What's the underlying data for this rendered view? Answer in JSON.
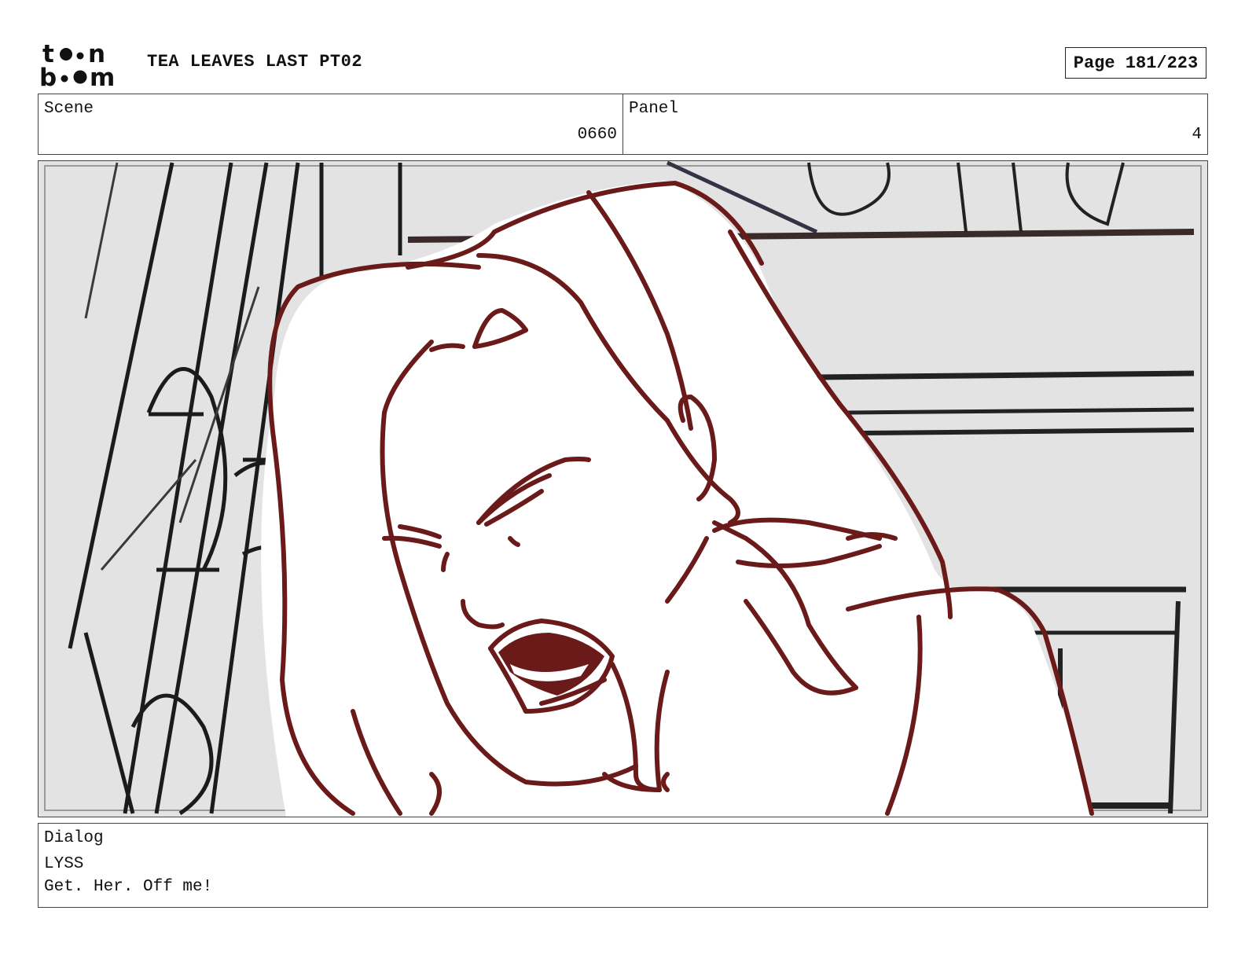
{
  "header": {
    "logo_top": "toon",
    "logo_bottom": "boom",
    "project_title": "TEA LEAVES LAST PT02",
    "page_indicator": "Page 181/223"
  },
  "info": {
    "scene_label": "Scene",
    "scene_value": "0660",
    "panel_label": "Panel",
    "panel_value": "4"
  },
  "dialog": {
    "label": "Dialog",
    "speaker": "LYSS",
    "line": "Get. Her. Off me!"
  },
  "colors": {
    "sketch_line": "#6b1a1a",
    "background_gray": "#e3e3e3",
    "border": "#444444"
  }
}
